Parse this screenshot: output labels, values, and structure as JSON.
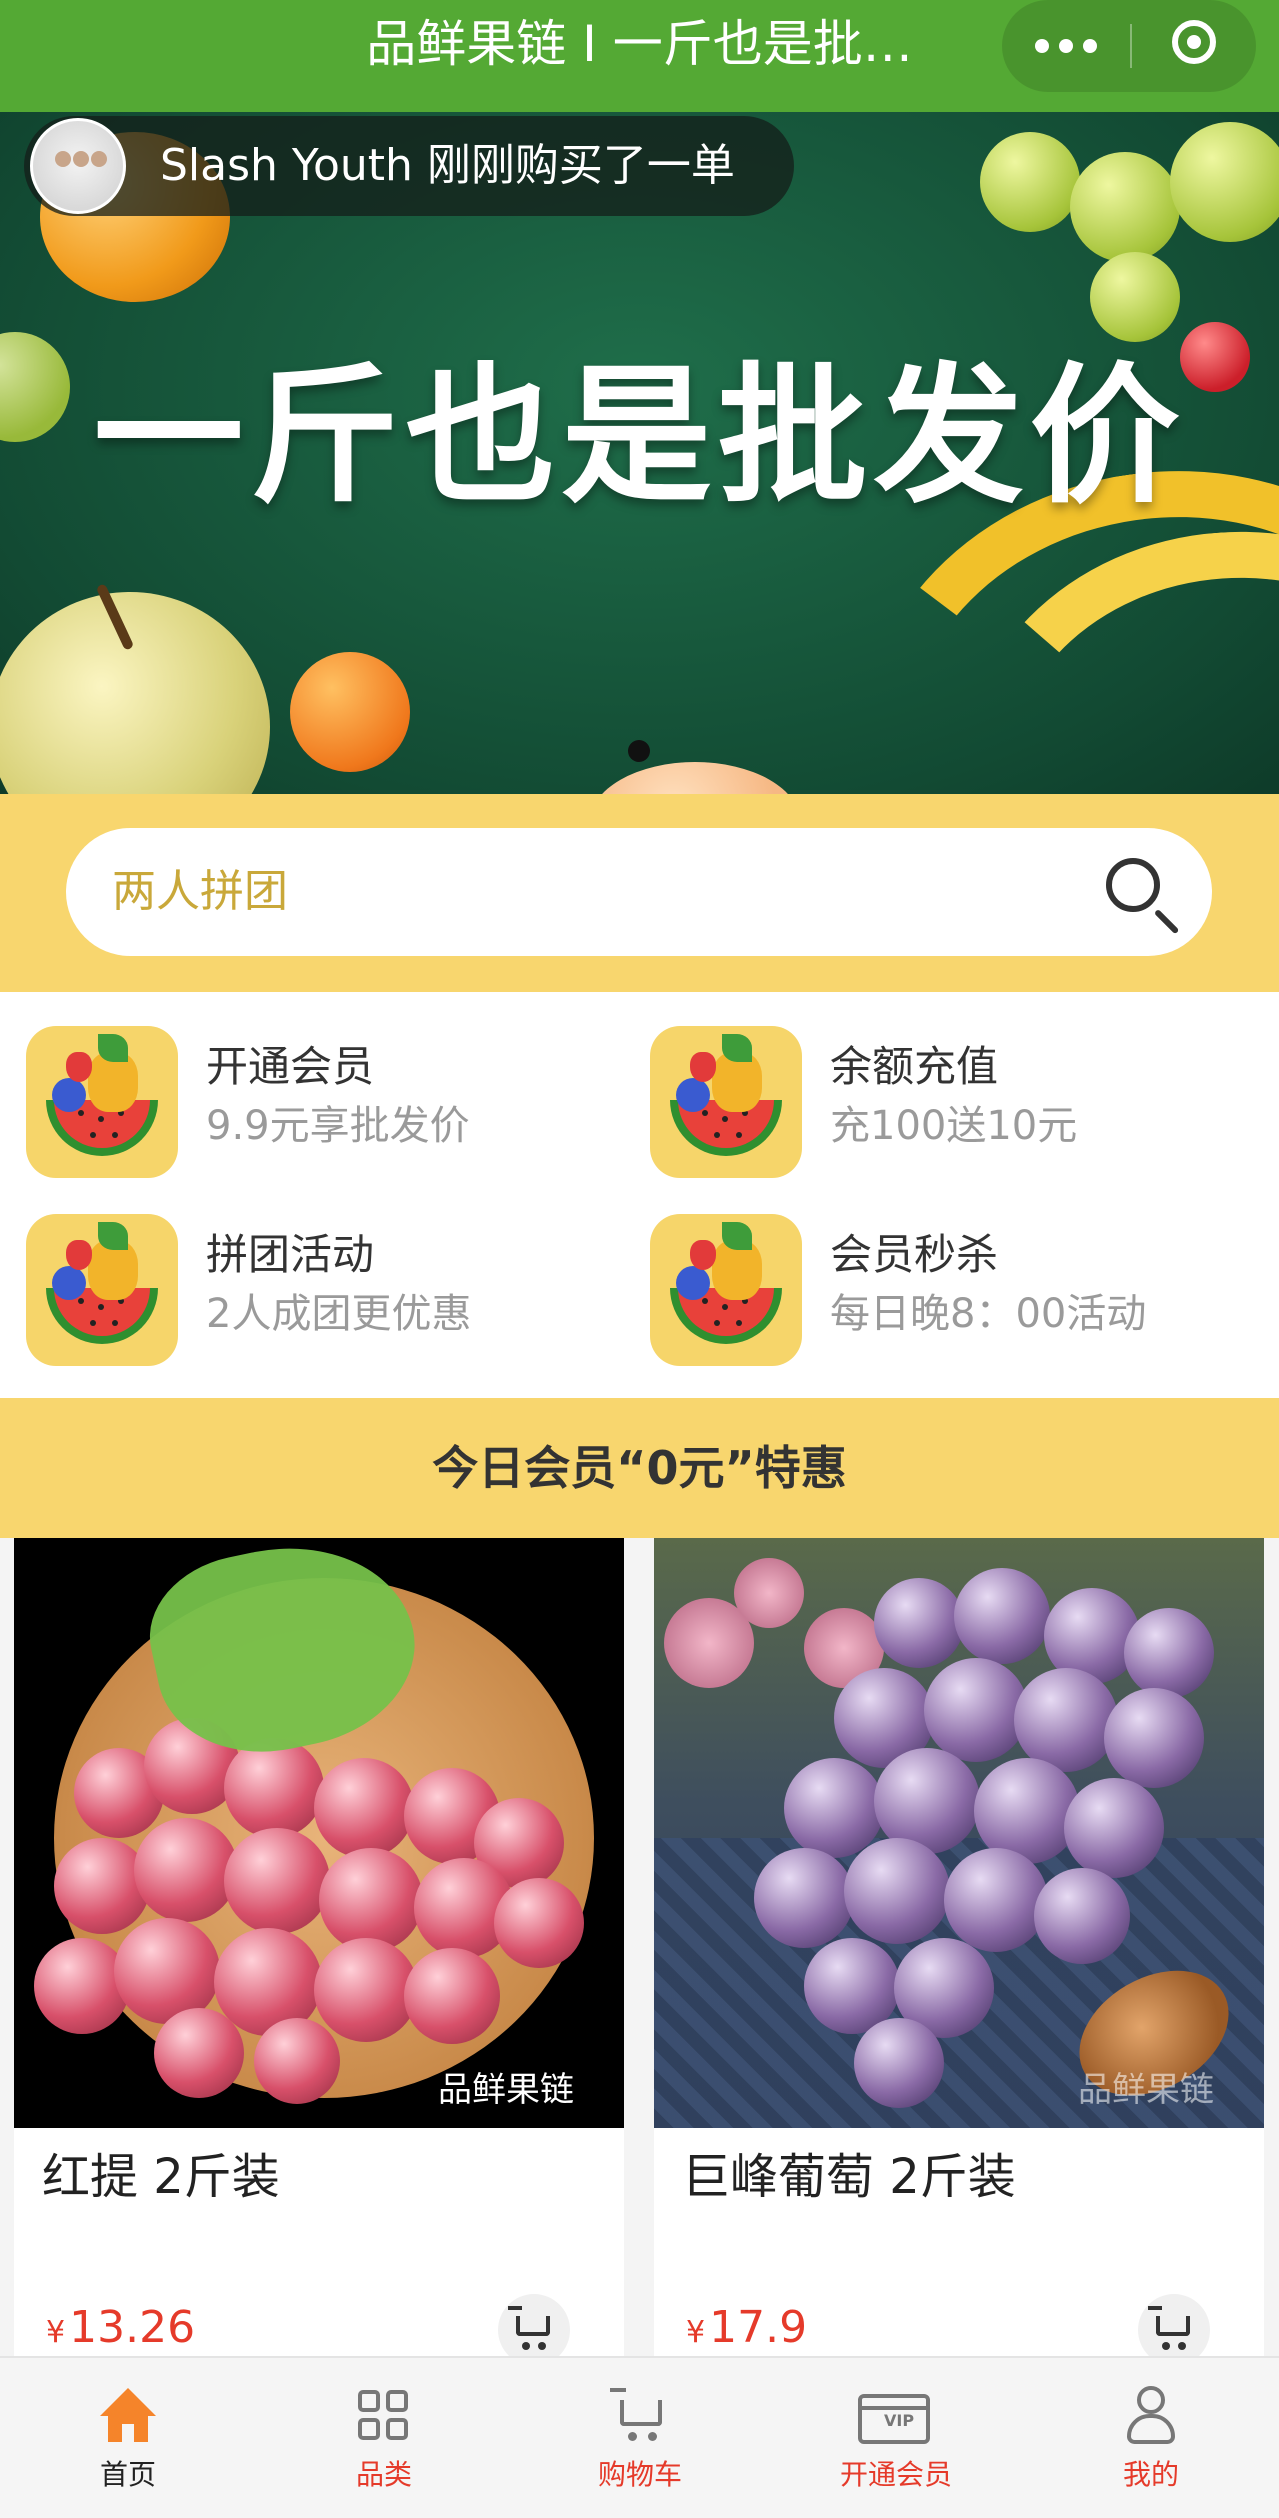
{
  "header": {
    "title": "品鲜果链 I 一斤也是批…",
    "more_icon": "more-dots-icon",
    "close_icon": "close-circle-icon",
    "bg_color": "#54a934"
  },
  "banner": {
    "slogan": "一斤也是批发价",
    "purchase_toast": "Slash Youth 刚刚购买了一单"
  },
  "search": {
    "placeholder": "两人拼团",
    "icon": "search-icon"
  },
  "features": [
    {
      "name": "开通会员",
      "desc": "9.9元享批发价"
    },
    {
      "name": "余额充值",
      "desc": "充100送10元"
    },
    {
      "name": "拼团活动",
      "desc": "2人成团更优惠"
    },
    {
      "name": "会员秒杀",
      "desc": "每日晚8：00活动"
    }
  ],
  "section": {
    "title": "今日会员“0元”特惠"
  },
  "products": [
    {
      "name": "红提 2斤装",
      "currency": "¥",
      "price": "13.26",
      "watermark": "品鲜果链"
    },
    {
      "name": "巨峰葡萄 2斤装",
      "currency": "¥",
      "price": "17.9",
      "watermark": "品鲜果链"
    }
  ],
  "tabbar": [
    {
      "label": "首页",
      "icon": "home-icon",
      "active": true
    },
    {
      "label": "品类",
      "icon": "category-grid-icon",
      "active": false
    },
    {
      "label": "购物车",
      "icon": "cart-icon",
      "active": false
    },
    {
      "label": "开通会员",
      "icon": "vip-card-icon",
      "active": false
    },
    {
      "label": "我的",
      "icon": "user-icon",
      "active": false
    }
  ],
  "colors": {
    "accent_green": "#54a934",
    "accent_yellow": "#f8d66e",
    "price_red": "#e53a2a",
    "tab_active_icon": "#f5842a"
  }
}
